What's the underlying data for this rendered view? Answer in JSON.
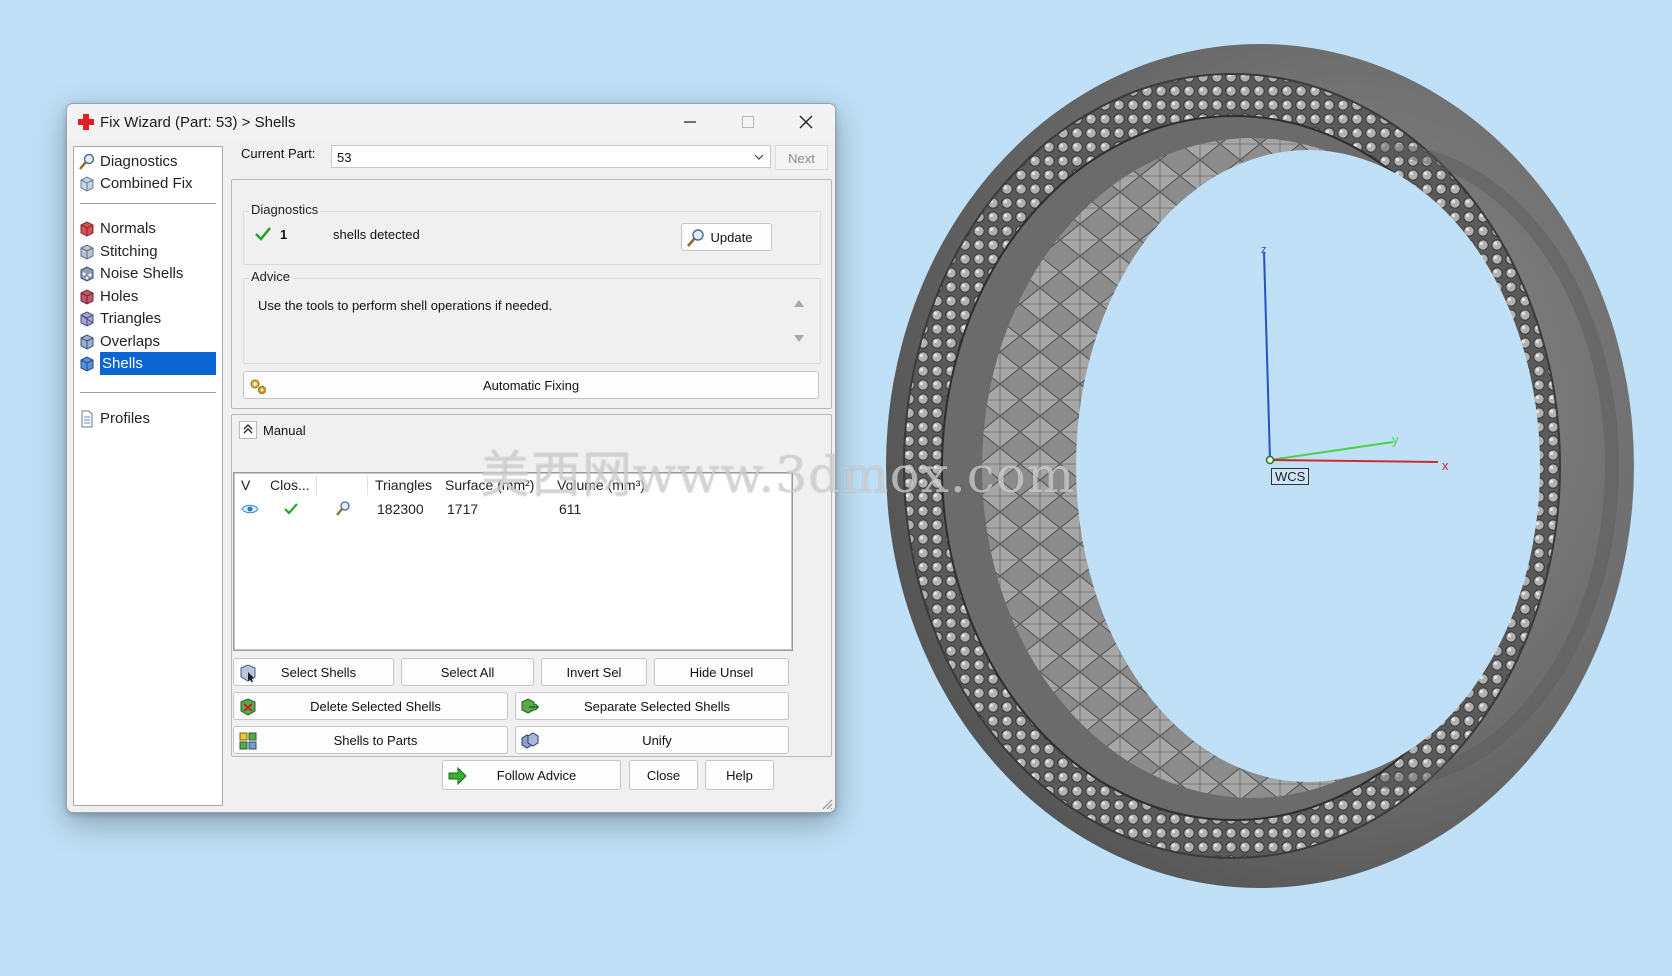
{
  "window": {
    "title": "Fix Wizard (Part: 53) > Shells",
    "controls": [
      "minimize",
      "maximize",
      "close"
    ]
  },
  "nav": {
    "items": [
      {
        "label": "Diagnostics",
        "icon": "magnifier-icon"
      },
      {
        "label": "Combined Fix",
        "icon": "cube-icon"
      },
      {
        "label": "Normals",
        "icon": "normals-cube-icon"
      },
      {
        "label": "Stitching",
        "icon": "stitching-cube-icon"
      },
      {
        "label": "Noise Shells",
        "icon": "noise-shells-icon"
      },
      {
        "label": "Holes",
        "icon": "holes-cube-icon"
      },
      {
        "label": "Triangles",
        "icon": "triangles-cube-icon"
      },
      {
        "label": "Overlaps",
        "icon": "overlaps-cube-icon"
      },
      {
        "label": "Shells",
        "icon": "shells-cube-icon",
        "selected": true
      },
      {
        "label": "Profiles",
        "icon": "document-icon"
      }
    ]
  },
  "current_part": {
    "label": "Current Part:",
    "value": "53",
    "next_label": "Next"
  },
  "diagnostics": {
    "legend": "Diagnostics",
    "count": "1",
    "text": "shells detected",
    "update_label": "Update"
  },
  "advice": {
    "legend": "Advice",
    "text": "Use the tools to perform shell operations if needed."
  },
  "automatic_fixing_label": "Automatic Fixing",
  "manual": {
    "label": "Manual",
    "columns": [
      "V",
      "Clos...",
      "",
      "Triangles",
      "Surface (mm²)",
      "Volume (mm³)"
    ],
    "rows": [
      {
        "triangles": "182300",
        "surface": "1717",
        "volume": "611"
      }
    ],
    "buttons": {
      "select_shells": "Select Shells",
      "select_all": "Select All",
      "invert_sel": "Invert Sel",
      "hide_unsel": "Hide Unsel",
      "delete_selected": "Delete Selected Shells",
      "separate_selected": "Separate Selected Shells",
      "shells_to_parts": "Shells to Parts",
      "unify": "Unify"
    }
  },
  "footer": {
    "follow_advice": "Follow Advice",
    "close": "Close",
    "help": "Help"
  },
  "viewport": {
    "axes": {
      "z": "z",
      "y": "y",
      "x": "x",
      "wcs": "WCS"
    },
    "watermark": "美西网www.3dmox.com"
  },
  "colors": {
    "selection": "#0a64d2",
    "background": "#bfe0f7",
    "check": "#2aa52a"
  }
}
